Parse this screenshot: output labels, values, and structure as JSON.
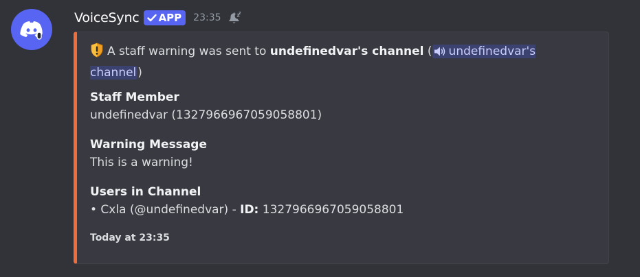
{
  "message": {
    "username": "VoiceSync",
    "badge": "APP",
    "time": "23:35"
  },
  "embed": {
    "accent_color": "#ef6d3b",
    "description_prefix": "A staff warning was sent to",
    "description_bold": "undefinedvar's channel",
    "paren_open": "(",
    "channel_mention": "undefinedvar's channel",
    "paren_close": ")",
    "fields": [
      {
        "name": "Staff Member",
        "value": "undefinedvar (1327966967059058801)"
      },
      {
        "name": "Warning Message",
        "value": "This is a warning!"
      },
      {
        "name": "Users in Channel",
        "value_prefix": "• Cxla (@undefinedvar) - ",
        "value_label": "ID:",
        "value_id": "1327966967059058801"
      }
    ],
    "footer": "Today at 23:35"
  },
  "icons": {
    "avatar": "discord-logo-icon",
    "badge": "checkmark-icon",
    "silent": "silent-bell-icon",
    "description": "warning-shield-icon",
    "mention": "speaker-icon"
  },
  "colors": {
    "background": "#323339",
    "embed_background": "#393a41",
    "app_badge": "#5865f2",
    "mention_background": "#3c4270"
  }
}
